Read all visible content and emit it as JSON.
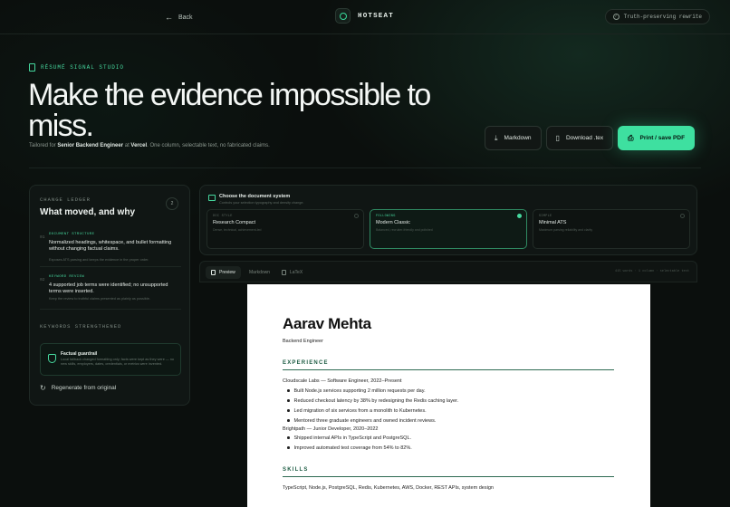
{
  "topbar": {
    "back_label": "Back",
    "brand": "HOTSEAT",
    "badge": "Truth-preserving rewrite"
  },
  "hero": {
    "eyebrow": "RÉSUMÉ SIGNAL STUDIO",
    "title": "Make the evidence impossible to miss.",
    "sub_prefix": "Tailored for",
    "role": "Senior Backend Engineer",
    "sub_at": "at",
    "company": "Vercel",
    "sub_suffix": ". One column, selectable text, no fabricated claims."
  },
  "actions": {
    "markdown": "Markdown",
    "tex": "Download .tex",
    "pdf": "Print / save PDF"
  },
  "ledger": {
    "label": "CHANGE LEDGER",
    "title": "What moved, and why",
    "count": "2",
    "entries": [
      {
        "num": "01",
        "tag": "DOCUMENT STRUCTURE",
        "text": "Normalized headings, whitespace, and bullet formatting without changing factual claims.",
        "note": "Exposes ATS parsing and keeps the evidence in the proper order."
      },
      {
        "num": "02",
        "tag": "KEYWORD REVIEW",
        "text": "4 supported job terms were identified; no unsupported terms were inserted.",
        "note": "Keep the review to truthful claims presented as plainly as possible."
      }
    ],
    "keywords_label": "KEYWORDS STRENGTHENED",
    "guard_title": "Factual guardrail",
    "guard_text": "Local fallback changed formatting only; facts were kept as they were — no new skills, employers, dates, credentials, or metrics were invented.",
    "regen": "Regenerate from original"
  },
  "docsys": {
    "title": "Choose the document system",
    "subtitle": "Controls your selection typography and density change.",
    "options": [
      {
        "kicker": "DOC STYLE",
        "name": "Research Compact",
        "desc": "Dense, technical, achievement-led",
        "selected": false
      },
      {
        "kicker": "FOLLOWING",
        "name": "Modern Classic",
        "desc": "Balanced, recruiter-friendly and polished",
        "selected": true
      },
      {
        "kicker": "SIMPLE",
        "name": "Minimal ATS",
        "desc": "Maximum parsing reliability and clarity",
        "selected": false
      }
    ]
  },
  "preview_tabs": {
    "preview": "Preview",
    "markdown": "Markdown",
    "latex": "LaTeX",
    "meta": "415 words · 1 column · selectable text"
  },
  "resume": {
    "name": "Aarav Mehta",
    "title": "Backend Engineer",
    "experience_label": "EXPERIENCE",
    "job1": "Cloudscale Labs — Software Engineer, 2022–Present",
    "job1_bullets": [
      "Built Node.js services supporting 2 million requests per day.",
      "Reduced checkout latency by 38% by redesigning the Redis caching layer.",
      "Led migration of six services from a monolith to Kubernetes.",
      "Mentored three graduate engineers and owned incident reviews."
    ],
    "job2": "Brightpath — Junior Developer, 2020–2022",
    "job2_bullets": [
      "Shipped internal APIs in TypeScript and PostgreSQL.",
      "Improved automated test coverage from 54% to 82%."
    ],
    "skills_label": "SKILLS",
    "skills": "TypeScript, Node.js, PostgreSQL, Redis, Kubernetes, AWS, Docker, REST APIs, system design"
  },
  "colors": {
    "accent": "#3ee0a0",
    "background": "#0b0f0d",
    "resume_rule": "#2e6a52"
  }
}
